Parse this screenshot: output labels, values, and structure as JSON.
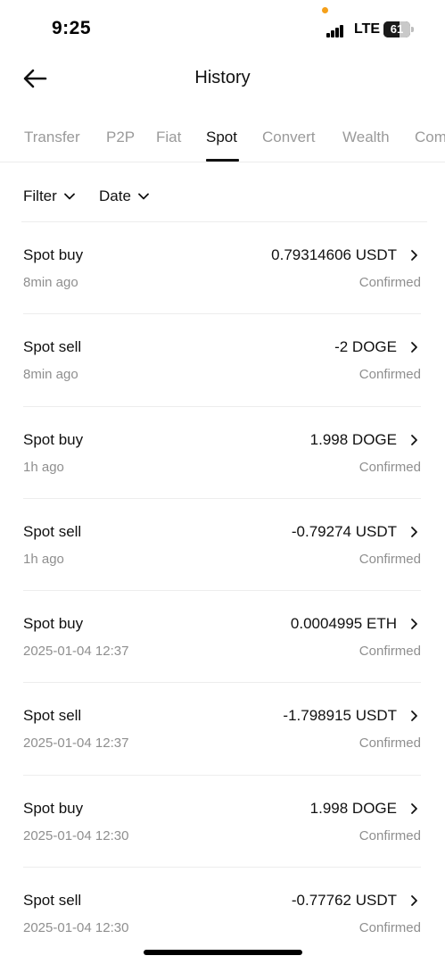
{
  "status_bar": {
    "time": "9:25",
    "network": "LTE",
    "battery": "61",
    "battery_level": 0.61
  },
  "header": {
    "title": "History"
  },
  "tabs": [
    {
      "label": "Transfer",
      "active": false
    },
    {
      "label": "P2P",
      "active": false
    },
    {
      "label": "Fiat",
      "active": false
    },
    {
      "label": "Spot",
      "active": true
    },
    {
      "label": "Convert",
      "active": false
    },
    {
      "label": "Wealth",
      "active": false
    },
    {
      "label": "Com",
      "active": false
    }
  ],
  "filters": {
    "filter_label": "Filter",
    "date_label": "Date"
  },
  "transactions": [
    {
      "type": "Spot buy",
      "time": "8min ago",
      "amount": "0.79314606 USDT",
      "status": "Confirmed"
    },
    {
      "type": "Spot sell",
      "time": "8min ago",
      "amount": "-2 DOGE",
      "status": "Confirmed"
    },
    {
      "type": "Spot buy",
      "time": "1h ago",
      "amount": "1.998 DOGE",
      "status": "Confirmed"
    },
    {
      "type": "Spot sell",
      "time": "1h ago",
      "amount": "-0.79274 USDT",
      "status": "Confirmed"
    },
    {
      "type": "Spot buy",
      "time": "2025-01-04 12:37",
      "amount": "0.0004995 ETH",
      "status": "Confirmed"
    },
    {
      "type": "Spot sell",
      "time": "2025-01-04 12:37",
      "amount": "-1.798915 USDT",
      "status": "Confirmed"
    },
    {
      "type": "Spot buy",
      "time": "2025-01-04 12:30",
      "amount": "1.998 DOGE",
      "status": "Confirmed"
    },
    {
      "type": "Spot sell",
      "time": "2025-01-04 12:30",
      "amount": "-0.77762 USDT",
      "status": "Confirmed"
    }
  ],
  "colors": {
    "text_primary": "#111111",
    "text_secondary": "#8f8f8f",
    "tab_inactive": "#9a9a9a",
    "divider": "#ededed",
    "status_dot": "#f5a01a"
  },
  "icons": {
    "back": "arrow-left-icon",
    "dropdown": "chevron-down-icon",
    "row_action": "chevron-right-icon"
  }
}
